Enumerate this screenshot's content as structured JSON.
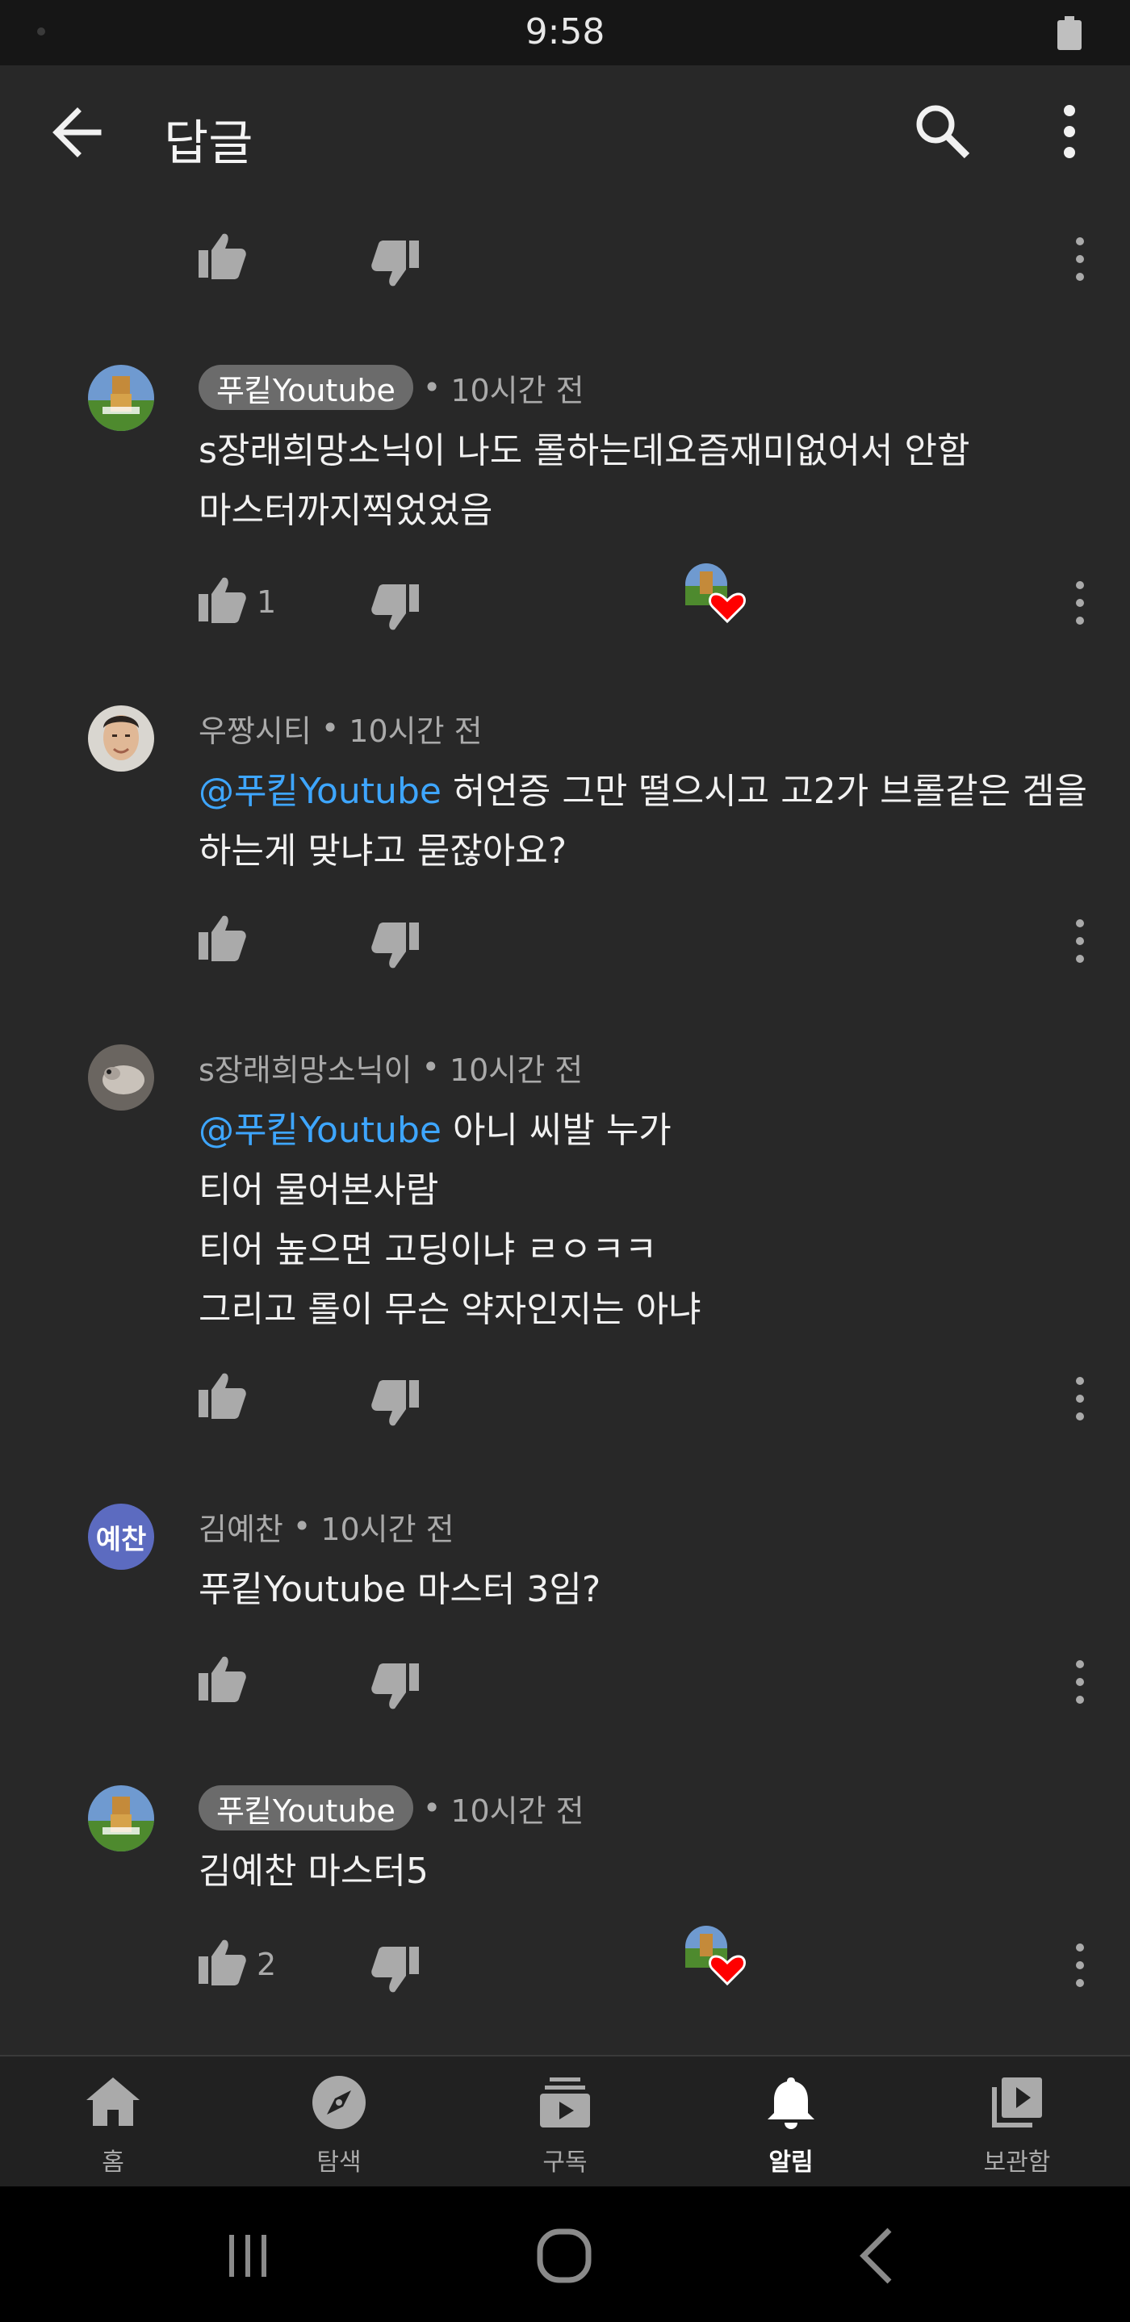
{
  "status_bar": {
    "time": "9:58"
  },
  "app_bar": {
    "title": "답글",
    "back_icon": "arrow-left-icon",
    "search_icon": "search-icon",
    "more_icon": "more-vert-icon"
  },
  "top_row": {
    "like_count": ""
  },
  "comments": [
    {
      "author": "푸킽Youtube",
      "is_creator": true,
      "time": "10시간 전",
      "lines": [
        "s장래희망소닉이 나도 롤하는데요즘재미없어서 안함",
        "마스터까지찍었었음"
      ],
      "mention": "",
      "like_count": "1",
      "hearted": true
    },
    {
      "author": "우짱시티",
      "is_creator": false,
      "time": "10시간 전",
      "mention": "@푸킽Youtube",
      "lines": [
        " 허언증 그만 떨으시고 고2가 브롤같은 겜을",
        "하는게 맞냐고 묻잖아요?"
      ],
      "like_count": "",
      "hearted": false
    },
    {
      "author": "s장래희망소닉이",
      "is_creator": false,
      "time": "10시간 전",
      "mention": "@푸킽Youtube",
      "lines": [
        " 아니  씨발 누가",
        "티어 물어본사람",
        "티어 높으면 고딩이냐 ㄹㅇㅋㅋ",
        "그리고 롤이 무슨 약자인지는 아냐"
      ],
      "like_count": "",
      "hearted": false
    },
    {
      "author": "김예찬",
      "avatar_text": "예찬",
      "is_creator": false,
      "time": "10시간 전",
      "mention": "",
      "lines": [
        "푸킽Youtube 마스터 3임?"
      ],
      "like_count": "",
      "hearted": false
    },
    {
      "author": "푸킽Youtube",
      "is_creator": true,
      "time": "10시간 전",
      "mention": "",
      "lines": [
        "김예찬 마스터5"
      ],
      "like_count": "2",
      "hearted": true
    }
  ],
  "separator": "•",
  "bottom_nav": [
    {
      "label": "홈",
      "icon": "home-icon",
      "active": false
    },
    {
      "label": "탐색",
      "icon": "explore-icon",
      "active": false
    },
    {
      "label": "구독",
      "icon": "subscriptions-icon",
      "active": false
    },
    {
      "label": "알림",
      "icon": "bell-icon",
      "active": true
    },
    {
      "label": "보관함",
      "icon": "library-icon",
      "active": false
    }
  ],
  "colors": {
    "background": "#282828",
    "mention": "#3ea6ff",
    "chip": "#6b6b6b",
    "heart": "#ff0000"
  }
}
